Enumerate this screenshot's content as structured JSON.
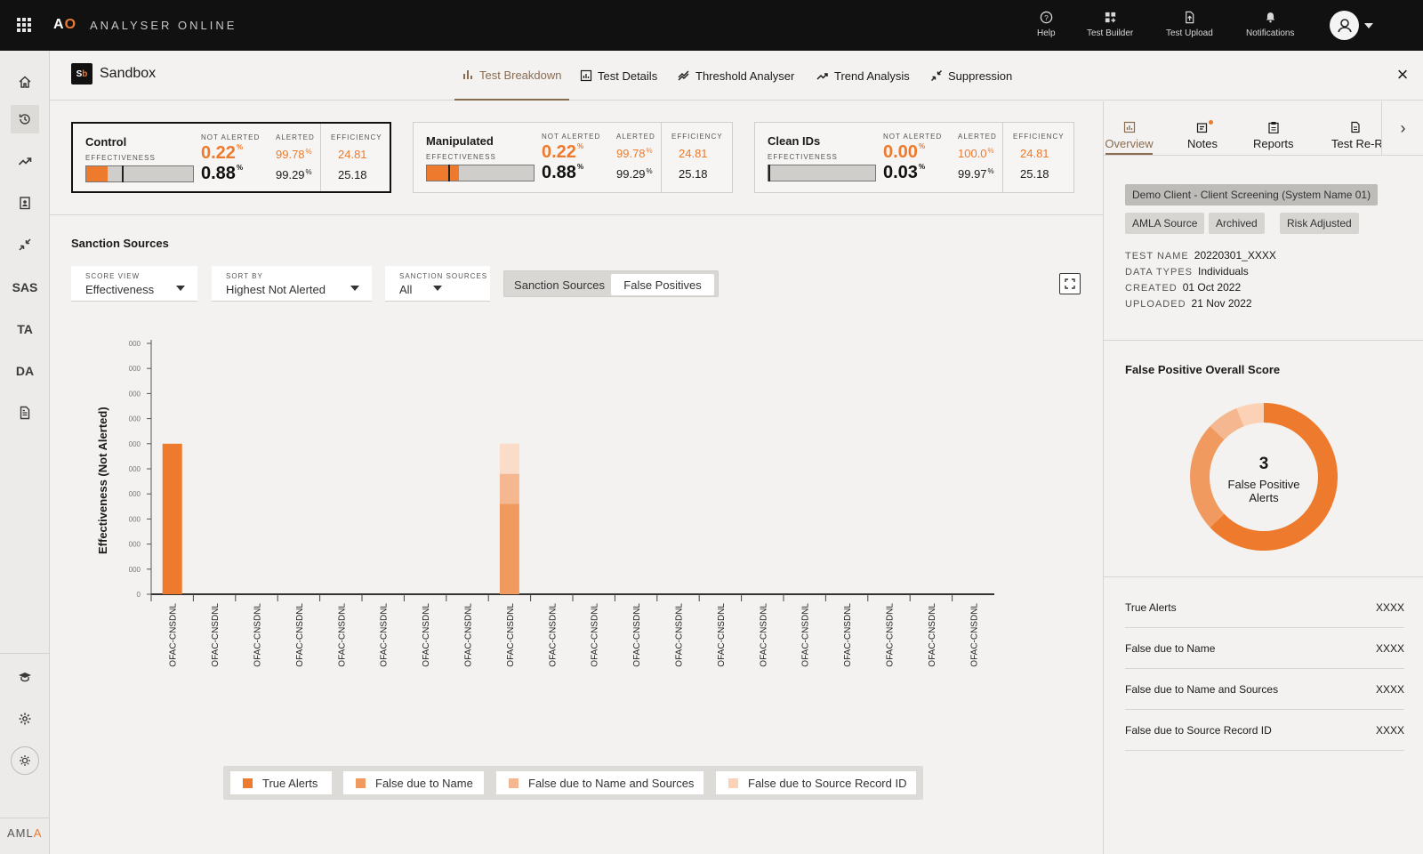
{
  "app": {
    "logo_a": "A",
    "logo_o": "O",
    "brand_name": "ANALYSER ONLINE"
  },
  "top_actions": [
    {
      "label": "Help",
      "icon": "help-circle-icon"
    },
    {
      "label": "Test Builder",
      "icon": "grid-plus-icon"
    },
    {
      "label": "Test Upload",
      "icon": "file-upload-icon"
    },
    {
      "label": "Notifications",
      "icon": "bell-icon"
    }
  ],
  "leftnav": {
    "items": [
      {
        "icon": "home-icon"
      },
      {
        "icon": "history-icon",
        "active": true
      },
      {
        "icon": "trend-icon"
      },
      {
        "icon": "id-badge-icon"
      },
      {
        "icon": "suppression-icon"
      },
      {
        "text": "SAS"
      },
      {
        "text": "TA"
      },
      {
        "text": "DA"
      },
      {
        "icon": "document-icon"
      }
    ],
    "bottom": [
      {
        "icon": "graduation-cap-icon"
      },
      {
        "icon": "gear-icon"
      },
      {
        "icon": "sun-icon"
      }
    ],
    "footer_logo": {
      "a": "AML",
      "o": "A"
    }
  },
  "workspace": {
    "badge": {
      "s": "S",
      "b": "b"
    },
    "title": "Sandbox",
    "tabs": [
      {
        "label": "Test Breakdown",
        "active": true
      },
      {
        "label": "Test Details"
      },
      {
        "label": "Threshold Analyser"
      },
      {
        "label": "Trend Analysis"
      },
      {
        "label": "Suppression"
      }
    ]
  },
  "cards": [
    {
      "name": "Control",
      "eff_label": "EFFECTIVENESS",
      "not_alerted_label": "NOT ALERTED",
      "alerted_label": "ALERTED",
      "efficiency_label": "EFFICIENCY",
      "na1": "0.22",
      "na2": "0.88",
      "al1": "99.78",
      "al2": "99.29",
      "ef1": "24.81",
      "ef2": "25.18",
      "fill": 0.2,
      "marker": 0.33,
      "selected": true
    },
    {
      "name": "Manipulated",
      "eff_label": "EFFECTIVENESS",
      "not_alerted_label": "NOT ALERTED",
      "alerted_label": "ALERTED",
      "efficiency_label": "EFFICIENCY",
      "na1": "0.22",
      "na2": "0.88",
      "al1": "99.78",
      "al2": "99.29",
      "ef1": "24.81",
      "ef2": "25.18",
      "fill": 0.3,
      "marker": 0.2,
      "selected": false
    },
    {
      "name": "Clean IDs",
      "eff_label": "EFFECTIVENESS",
      "not_alerted_label": "NOT ALERTED",
      "alerted_label": "ALERTED",
      "efficiency_label": "EFFICIENCY",
      "na1": "0.00",
      "na2": "0.03",
      "al1": "100.0",
      "al2": "99.97",
      "ef1": "24.81",
      "ef2": "25.18",
      "fill": 0.0,
      "marker": 0.0,
      "selected": false
    }
  ],
  "sanction": {
    "title": "Sanction Sources",
    "score_view": {
      "label": "SCORE VIEW",
      "value": "Effectiveness"
    },
    "sort_by": {
      "label": "SORT BY",
      "value": "Highest Not Alerted"
    },
    "sources": {
      "label": "SANCTION SOURCES",
      "value": "All"
    },
    "toggle": [
      "Sanction Sources",
      "False Positives"
    ]
  },
  "chart_data": {
    "type": "bar",
    "stacked": true,
    "ylabel": "Effectiveness (Not Alerted)",
    "y_ticks": [
      "0",
      "000",
      "000",
      "000",
      "000",
      "000",
      "000",
      "000",
      "000",
      "000",
      "000"
    ],
    "categories": [
      "OFAC-CNSDNL",
      "OFAC-CNSDNL",
      "OFAC-CNSDNL",
      "OFAC-CNSDNL",
      "OFAC-CNSDNL",
      "OFAC-CNSDNL",
      "OFAC-CNSDNL",
      "OFAC-CNSDNL",
      "OFAC-CNSDNL",
      "OFAC-CNSDNL",
      "OFAC-CNSDNL",
      "OFAC-CNSDNL",
      "OFAC-CNSDNL",
      "OFAC-CNSDNL",
      "OFAC-CNSDNL",
      "OFAC-CNSDNL",
      "OFAC-CNSDNL",
      "OFAC-CNSDNL",
      "OFAC-CNSDNL",
      "OFAC-CNSDNL"
    ],
    "ylim": [
      0,
      10
    ],
    "series": [
      {
        "name": "True Alerts",
        "color": "#ee7a2d",
        "values": [
          6,
          0,
          0,
          0,
          0,
          0,
          0,
          0,
          0,
          0,
          0,
          0,
          0,
          0,
          0,
          0,
          0,
          0,
          0,
          0
        ]
      },
      {
        "name": "False due to Name",
        "color": "#f19a60",
        "values": [
          0,
          0,
          0,
          0,
          0,
          0,
          0,
          0,
          3.6,
          0,
          0,
          0,
          0,
          0,
          0,
          0,
          0,
          0,
          0,
          0
        ]
      },
      {
        "name": "False due to Name and Sources",
        "color": "#f5b790",
        "values": [
          0,
          0,
          0,
          0,
          0,
          0,
          0,
          0,
          1.2,
          0,
          0,
          0,
          0,
          0,
          0,
          0,
          0,
          0,
          0,
          0
        ]
      },
      {
        "name": "False due to Source Record ID",
        "color": "#fbdcc8",
        "values": [
          0,
          0,
          0,
          0,
          0,
          0,
          0,
          0,
          1.2,
          0,
          0,
          0,
          0,
          0,
          0,
          0,
          0,
          0,
          0,
          0
        ]
      }
    ],
    "legend": "bottom",
    "grid": false
  },
  "rpanel": {
    "tabs": [
      {
        "label": "Overview",
        "active": true
      },
      {
        "label": "Notes"
      },
      {
        "label": "Reports"
      },
      {
        "label": "Test Re-R"
      }
    ],
    "chips": [
      "Demo Client - Client Screening (System Name 01)",
      "AMLA Source",
      "Archived",
      "Risk Adjusted"
    ],
    "meta": [
      {
        "k": "TEST NAME",
        "v": "20220301_XXXX"
      },
      {
        "k": "DATA TYPES",
        "v": "Individuals"
      },
      {
        "k": "CREATED",
        "v": "01 Oct 2022"
      },
      {
        "k": "UPLOADED",
        "v": "21 Nov 2022"
      }
    ],
    "fp_title": "False Positive Overall Score",
    "donut": {
      "value": "3",
      "caption_1": "False Positive",
      "caption_2": "Alerts",
      "segments": [
        {
          "name": "True Alerts",
          "share": 0.63,
          "color": "#ee7a2d"
        },
        {
          "name": "False due to Name",
          "share": 0.24,
          "color": "#f19a60"
        },
        {
          "name": "False due to Name and Sources",
          "share": 0.07,
          "color": "#f5b790"
        },
        {
          "name": "False due to Source Record ID",
          "share": 0.06,
          "color": "#fbd2b6"
        }
      ]
    },
    "stats": [
      {
        "label": "True Alerts",
        "value": "XXXX"
      },
      {
        "label": "False due to Name",
        "value": "XXXX"
      },
      {
        "label": "False due to Name and Sources",
        "value": "XXXX"
      },
      {
        "label": "False due to Source Record ID",
        "value": "XXXX"
      }
    ]
  }
}
